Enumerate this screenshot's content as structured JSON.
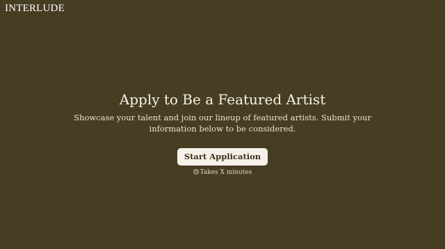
{
  "brand": {
    "name": "INTERLUDE"
  },
  "hero": {
    "title": "Apply to Be a Featured Artist",
    "description": "Showcase your talent and join our lineup of featured artists. Submit your information below to be considered.",
    "cta_label": "Start Application",
    "duration_note": "Takes X minutes",
    "duration_icon": "clock-icon"
  },
  "colors": {
    "background": "#463d23",
    "text": "#f4efe3",
    "button_background": "#f6f2ea",
    "button_text": "#3b321b"
  }
}
